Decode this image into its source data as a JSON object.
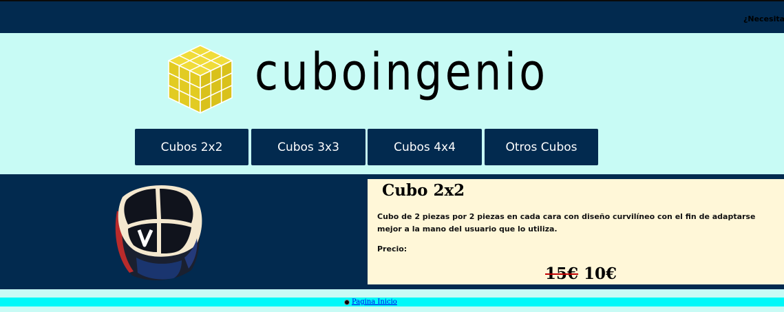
{
  "header": {
    "help_text": "¿Necesita"
  },
  "brand": {
    "logo_text": "cuboingenio",
    "logo_icon": "yellow-cube-logo-icon",
    "logo_color": "#e8d326"
  },
  "nav": {
    "items": [
      {
        "label": "Cubos 2x2"
      },
      {
        "label": "Cubos 3x3"
      },
      {
        "label": "Cubos 4x4"
      },
      {
        "label": "Otros Cubos"
      }
    ]
  },
  "product": {
    "title": "Cubo 2x2",
    "description": "Cubo de 2 piezas por 2 piezas en cada cara con diseño curvilíneo con el fin de adaptarse mejor a la mano del usuario que lo utiliza.",
    "price_label": "Precio:",
    "old_price": "15€",
    "new_price": "10€",
    "image": "rubik-2x2-cube-image"
  },
  "footer": {
    "link_text": "Pagina Inicio"
  },
  "colors": {
    "navy": "#022a4f",
    "page_bg": "#c8fbf5",
    "panel_bg": "#fff7d8",
    "footer_bar": "#00f8f8",
    "strike_red": "#c00000"
  }
}
